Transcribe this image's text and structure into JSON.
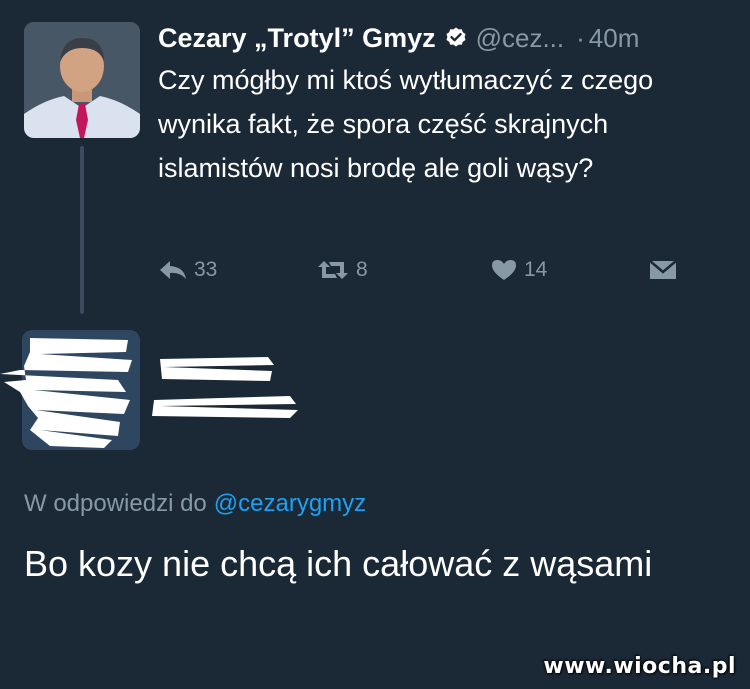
{
  "tweet": {
    "author": {
      "display_name": "Cezary „Trotyl” Gmyz",
      "handle": "@cez...",
      "verified_icon": "verified-badge-icon"
    },
    "separator": "·",
    "time": "40m",
    "text": "Czy mógłby mi ktoś wytłumaczyć z czego wynika fakt, że spora część skrajnych islamistów nosi brodę ale goli wąsy?",
    "actions": {
      "reply_count": "33",
      "retweet_count": "8",
      "like_count": "14",
      "reply_icon": "reply-icon",
      "retweet_icon": "retweet-icon",
      "like_icon": "heart-icon",
      "dm_icon": "envelope-icon"
    }
  },
  "reply": {
    "in_reply_prefix": "W odpowiedzi do",
    "in_reply_mention": "@cezarygmyz",
    "text": "Bo kozy nie chcą ich całować z wąsami"
  },
  "watermark": "www.wiocha.pl",
  "colors": {
    "background": "#1b2836",
    "secondary_text": "#8899a6",
    "link": "#1da1f2"
  }
}
